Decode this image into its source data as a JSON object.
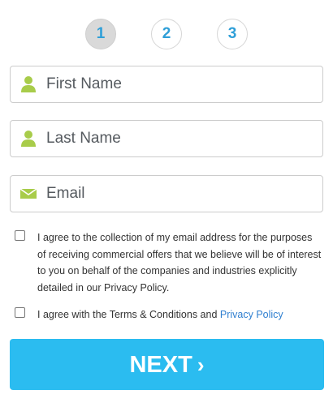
{
  "steps": [
    {
      "label": "1",
      "active": true
    },
    {
      "label": "2",
      "active": false
    },
    {
      "label": "3",
      "active": false
    }
  ],
  "form": {
    "first_name": {
      "placeholder": "First Name",
      "value": "",
      "icon": "user-icon"
    },
    "last_name": {
      "placeholder": "Last Name",
      "value": "",
      "icon": "user-icon"
    },
    "email": {
      "placeholder": "Email",
      "value": "",
      "icon": "envelope-icon"
    }
  },
  "consents": {
    "marketing": {
      "checked": false,
      "text": "I agree to the collection of my email address for the purposes of receiving commercial offers that we believe will be of interest to you on behalf of the companies and industries explicitly detailed in our Privacy Policy."
    },
    "terms": {
      "checked": false,
      "text_prefix": "I agree with the Terms & Conditions and ",
      "link_label": "Privacy Policy"
    }
  },
  "next_button": {
    "label": "NEXT",
    "chevron": "›"
  },
  "colors": {
    "accent": "#2bbcf0",
    "step_number": "#2f9fd8",
    "icon": "#a8cc4a",
    "link": "#2f7fd0"
  }
}
